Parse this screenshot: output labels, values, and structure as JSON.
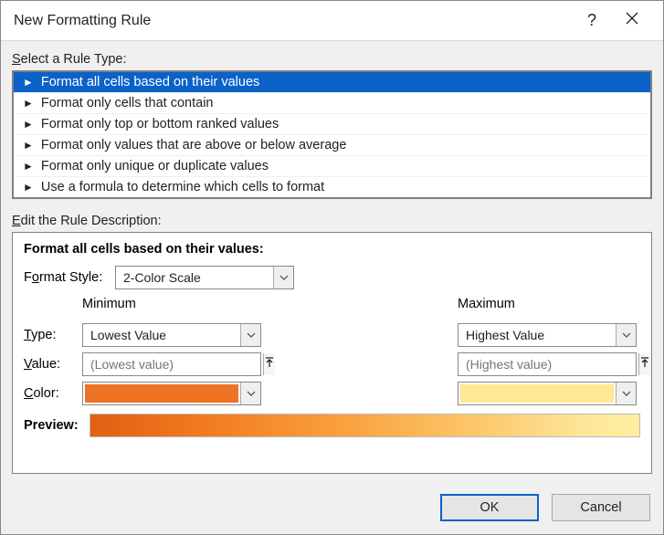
{
  "title": "New Formatting Rule",
  "section_select_label": "Select a Rule Type:",
  "rule_types": [
    "Format all cells based on their values",
    "Format only cells that contain",
    "Format only top or bottom ranked values",
    "Format only values that are above or below average",
    "Format only unique or duplicate values",
    "Use a formula to determine which cells to format"
  ],
  "selected_rule_index": 0,
  "section_edit_label": "Edit the Rule Description:",
  "desc_title": "Format all cells based on their values:",
  "format_style_label": "Format Style:",
  "format_style_value": "2-Color Scale",
  "columns": {
    "min_header": "Minimum",
    "max_header": "Maximum"
  },
  "row_labels": {
    "type": "Type:",
    "value": "Value:",
    "color": "Color:"
  },
  "min": {
    "type": "Lowest Value",
    "value_placeholder": "(Lowest value)",
    "color": "#ee7325"
  },
  "max": {
    "type": "Highest Value",
    "value_placeholder": "(Highest value)",
    "color": "#ffe993"
  },
  "preview_label": "Preview:",
  "buttons": {
    "ok": "OK",
    "cancel": "Cancel"
  }
}
